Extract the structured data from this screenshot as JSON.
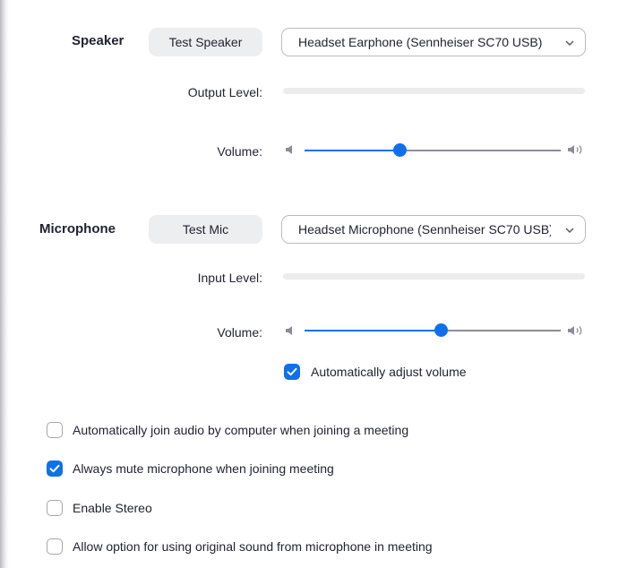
{
  "speaker": {
    "section_label": "Speaker",
    "test_button": "Test Speaker",
    "device": "Headset Earphone (Sennheiser SC70 USB)",
    "output_level_label": "Output Level:",
    "output_level": 0,
    "volume_label": "Volume:",
    "volume": 0.37
  },
  "microphone": {
    "section_label": "Microphone",
    "test_button": "Test Mic",
    "device": "Headset Microphone (Sennheiser SC70 USB)",
    "input_level_label": "Input Level:",
    "input_level": 0,
    "volume_label": "Volume:",
    "volume": 0.53,
    "auto_adjust": {
      "label": "Automatically adjust volume",
      "checked": true
    }
  },
  "options": [
    {
      "label": "Automatically join audio by computer when joining a meeting",
      "checked": false
    },
    {
      "label": "Always mute microphone when joining meeting",
      "checked": true
    },
    {
      "label": "Enable Stereo",
      "checked": false
    },
    {
      "label": "Allow option for using original sound from microphone in meeting",
      "checked": false
    }
  ],
  "colors": {
    "accent": "#0e71eb",
    "track": "#8c8c99",
    "level_bg": "#ececef"
  },
  "icons": {
    "dropdown": "chevron-down-icon",
    "volume_low": "volume-low-icon",
    "volume_high": "volume-high-icon",
    "check": "checkmark-icon"
  }
}
